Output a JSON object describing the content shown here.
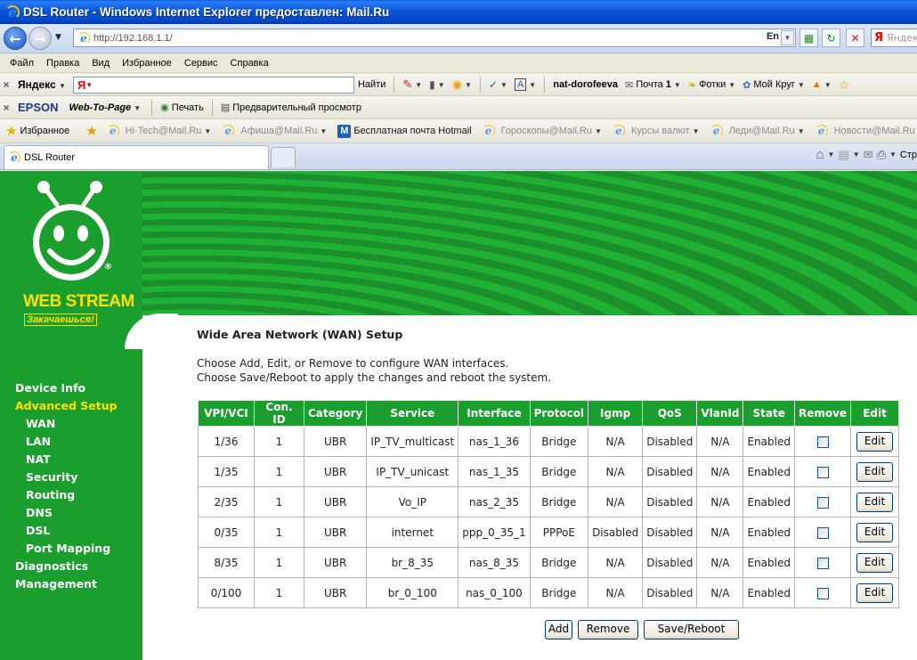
{
  "window": {
    "title": "DSL Router - Windows Internet Explorer предоставлен: Mail.Ru"
  },
  "address_bar": {
    "url": "http://192.168.1.1/",
    "lang": "En",
    "search_brand": "Я",
    "search_placeholder": "Яндекс"
  },
  "menu": [
    "Файл",
    "Правка",
    "Вид",
    "Избранное",
    "Сервис",
    "Справка"
  ],
  "yandex_toolbar": {
    "logo_text": "Яндекс",
    "search_button": "Найти",
    "user": "nat-dorofeeva",
    "mail": "Почта",
    "mail_count": "1",
    "photos": "Фотки",
    "circle": "Мой Круг"
  },
  "epson_toolbar": {
    "brand": "EPSON",
    "web_to_page": "Web-To-Page",
    "print": "Печать",
    "preview": "Предварительный просмотр"
  },
  "favorites_bar": {
    "label": "Избранное",
    "items": [
      "Hi-Tech@Mail.Ru",
      "Афиша@Mail.Ru",
      "Бесплатная почта Hotmail",
      "Гороскопы@Mail.Ru",
      "Курсы валют",
      "Леди@Mail.Ru",
      "Новости@Mail.Ru"
    ]
  },
  "tabs": {
    "active": "DSL Router",
    "cmd_page": "Стр"
  },
  "router": {
    "brand": "WEB STREAM",
    "slogan": "Закачаешься!",
    "nav": [
      {
        "label": "Device Info",
        "level": 0,
        "active": false
      },
      {
        "label": "Advanced Setup",
        "level": 0,
        "active": true
      },
      {
        "label": "WAN",
        "level": 1,
        "active": false
      },
      {
        "label": "LAN",
        "level": 1,
        "active": false
      },
      {
        "label": "NAT",
        "level": 1,
        "active": false
      },
      {
        "label": "Security",
        "level": 1,
        "active": false
      },
      {
        "label": "Routing",
        "level": 1,
        "active": false
      },
      {
        "label": "DNS",
        "level": 1,
        "active": false
      },
      {
        "label": "DSL",
        "level": 1,
        "active": false
      },
      {
        "label": "Port Mapping",
        "level": 1,
        "active": false
      },
      {
        "label": "Diagnostics",
        "level": 0,
        "active": false
      },
      {
        "label": "Management",
        "level": 0,
        "active": false
      }
    ],
    "title": "Wide Area Network (WAN) Setup",
    "desc1": "Choose Add, Edit, or Remove to configure WAN interfaces.",
    "desc2": "Choose Save/Reboot to apply the changes and reboot the system.",
    "columns": [
      "VPI/VCI",
      "Con. ID",
      "Category",
      "Service",
      "Interface",
      "Protocol",
      "Igmp",
      "QoS",
      "VlanId",
      "State",
      "Remove",
      "Edit"
    ],
    "rows": [
      [
        "1/36",
        "1",
        "UBR",
        "IP_TV_multicast",
        "nas_1_36",
        "Bridge",
        "N/A",
        "Disabled",
        "N/A",
        "Enabled"
      ],
      [
        "1/35",
        "1",
        "UBR",
        "IP_TV_unicast",
        "nas_1_35",
        "Bridge",
        "N/A",
        "Disabled",
        "N/A",
        "Enabled"
      ],
      [
        "2/35",
        "1",
        "UBR",
        "Vo_IP",
        "nas_2_35",
        "Bridge",
        "N/A",
        "Disabled",
        "N/A",
        "Enabled"
      ],
      [
        "0/35",
        "1",
        "UBR",
        "internet",
        "ppp_0_35_1",
        "PPPoE",
        "Disabled",
        "Disabled",
        "N/A",
        "Enabled"
      ],
      [
        "8/35",
        "1",
        "UBR",
        "br_8_35",
        "nas_8_35",
        "Bridge",
        "N/A",
        "Disabled",
        "N/A",
        "Enabled"
      ],
      [
        "0/100",
        "1",
        "UBR",
        "br_0_100",
        "nas_0_100",
        "Bridge",
        "N/A",
        "Disabled",
        "N/A",
        "Enabled"
      ]
    ],
    "edit_label": "Edit",
    "buttons": {
      "add": "Add",
      "remove": "Remove",
      "save": "Save/Reboot"
    }
  },
  "colors": {
    "router_green": "#1a9f2f",
    "accent_yellow": "#ffe000",
    "xp_blue": "#0a56d8"
  }
}
